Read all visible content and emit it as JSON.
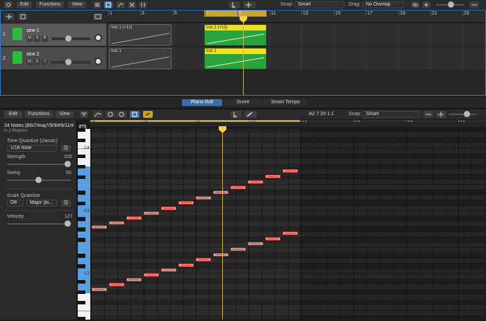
{
  "top_toolbar": {
    "edit": "Edit",
    "functions": "Functions",
    "view": "View",
    "snap_label": "Snap:",
    "snap_value": "Smart",
    "drag_label": "Drag:",
    "drag_value": "No Overlap"
  },
  "ruler_top": {
    "bars": [
      "1",
      "3",
      "5",
      "7",
      "9",
      "11",
      "13",
      "15",
      "17",
      "19",
      "21",
      "23"
    ]
  },
  "tracks": [
    {
      "number": "1",
      "name": "sine 1",
      "mute": "M",
      "solo": "S",
      "rec": "R"
    },
    {
      "number": "2",
      "name": "sine 2",
      "mute": "M",
      "solo": "S",
      "rec": "R"
    }
  ],
  "regions": [
    {
      "name": "Inst 1 (+12)",
      "selected": false
    },
    {
      "name": "Inst 1 (+12)",
      "selected": true
    },
    {
      "name": "Inst 1",
      "selected": false
    },
    {
      "name": "Inst 1",
      "selected": true
    }
  ],
  "editor_tabs": [
    "Piano Roll",
    "Score",
    "Smart Tempo"
  ],
  "editor_toolbar": {
    "edit": "Edit",
    "functions": "Functions",
    "view": "View",
    "position": "A2  7 20 1 1",
    "snap_label": "Snap:",
    "snap_value": "Smart"
  },
  "inspector": {
    "title": "24 Notes (B6/7/maj7/9/9/#9/11/#1...",
    "subtitle": "in 2 Regions",
    "time_quantize_label": "Time Quantize (classic)",
    "time_quantize_value": "1/16 Note",
    "q_button": "Q",
    "strength_label": "Strength",
    "strength_value": "100",
    "strength_level": 1.0,
    "swing_label": "Swing",
    "swing_value": "50",
    "swing_level": 0.5,
    "scale_quantize_label": "Scale Quantize",
    "scale_off": "Off",
    "scale_mode": "Major [Io...",
    "velocity_label": "Velocity",
    "velocity_value": "127",
    "velocity_level": 1.0
  },
  "ruler_editor": {
    "bars": [
      "7",
      "8",
      "9",
      "10",
      "11",
      "12",
      "13",
      "14"
    ]
  },
  "piano_labels": [
    "C4",
    "C3",
    "C2"
  ],
  "colors": {
    "accent_blue": "#3c6ea5",
    "region_green": "#2aa43a",
    "region_header_yellow": "#f2df1e",
    "cycle_gold": "#c9a227",
    "note_fill": "#f1a9a6",
    "note_border": "#c13a36",
    "playhead": "#f3cf45"
  },
  "icons": [
    "settings-icon",
    "list-icon",
    "piano-roll-icon",
    "scissors-icon",
    "mixer-icon",
    "pointer-tool-icon",
    "plus-tool-icon",
    "waveform-icon",
    "zoom-icon",
    "plus-icon",
    "duplicate-icon",
    "dial-icon",
    "pencil-tool-icon",
    "catch-icon",
    "link-icon",
    "lcd-icon"
  ]
}
